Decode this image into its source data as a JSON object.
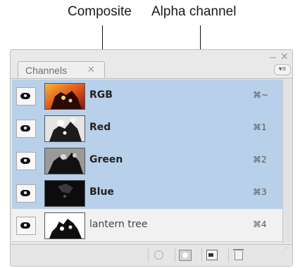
{
  "callouts": {
    "composite": "Composite",
    "alpha": "Alpha channel"
  },
  "panel": {
    "tab_label": "Channels",
    "tab_close_glyph": "✕",
    "minimize_glyph": "–",
    "close_glyph": "✕",
    "menu_glyph": "▾≡"
  },
  "channels": [
    {
      "name": "RGB",
      "shortcut": "⌘~",
      "thumb": "rgb-thumbnail",
      "selected": true
    },
    {
      "name": "Red",
      "shortcut": "⌘1",
      "thumb": "red-thumbnail",
      "selected": true
    },
    {
      "name": "Green",
      "shortcut": "⌘2",
      "thumb": "green-thumbnail",
      "selected": true
    },
    {
      "name": "Blue",
      "shortcut": "⌘3",
      "thumb": "blue-thumbnail",
      "selected": true
    },
    {
      "name": "lantern tree",
      "shortcut": "⌘4",
      "thumb": "alpha-thumbnail",
      "selected": false
    }
  ],
  "footer": {
    "buttons": [
      "load-selection-icon",
      "save-selection-icon",
      "new-channel-icon",
      "trash-icon"
    ]
  },
  "colors": {
    "selected_row": "#b9d0ea",
    "unselected_row": "#f1f1f1",
    "panel_bg": "#e9e9e9"
  }
}
